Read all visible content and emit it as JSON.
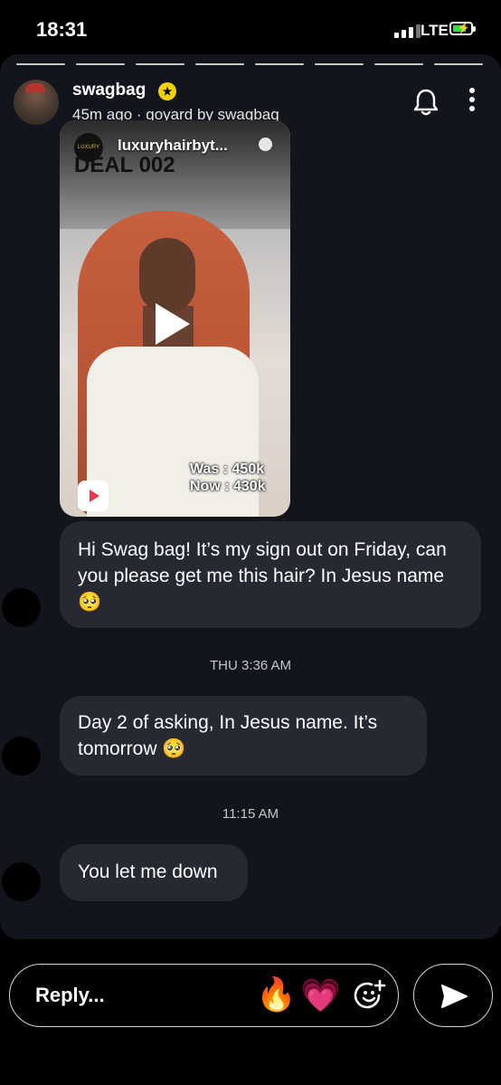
{
  "status_bar": {
    "time": "18:31",
    "network": "LTE"
  },
  "story": {
    "username": "swagbag",
    "meta": "45m ago · goyard by swagbag",
    "progress_segments": 8
  },
  "shared_post": {
    "account": "luxuryhairbyt...",
    "logo_text": "LUXURY",
    "deal_text": "DEAL 002",
    "price_was": "Was : 450k",
    "price_now": "Now : 430k"
  },
  "messages": [
    {
      "text": "Hi Swag bag! It’s my sign out on Friday, can you please get me this hair? In Jesus name 🥺"
    },
    {
      "timestamp": "THU 3:36 AM",
      "text": "Day 2 of asking, In Jesus name. It’s tomorrow 🥺"
    },
    {
      "timestamp": "11:15 AM",
      "text": "You let me down"
    }
  ],
  "reply_bar": {
    "placeholder": "Reply...",
    "reaction_1": "🔥",
    "reaction_2": "💗"
  }
}
